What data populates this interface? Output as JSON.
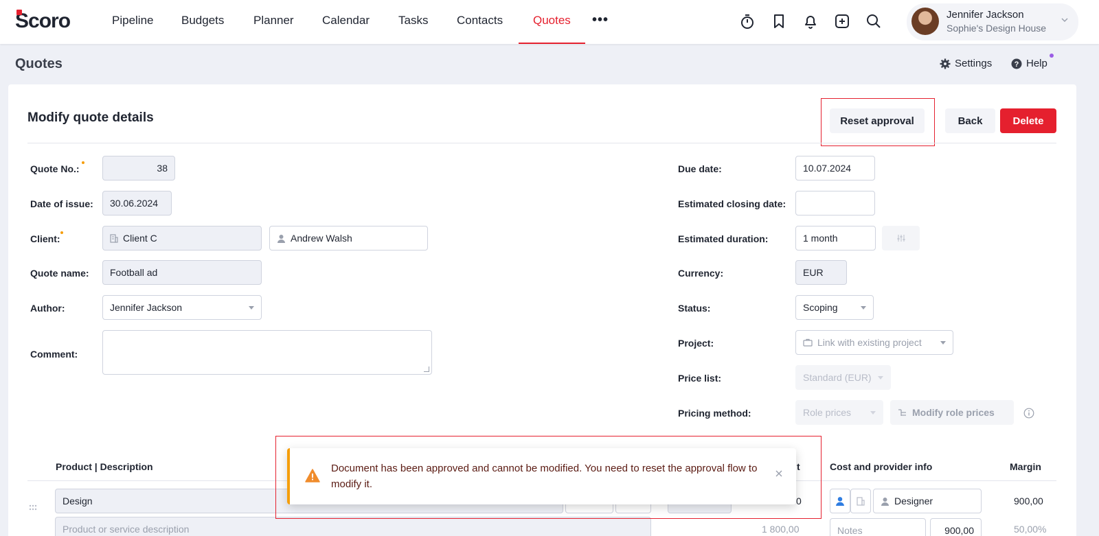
{
  "brand": {
    "logo_text": "Scoro",
    "accent": "#e5202e"
  },
  "nav": {
    "items": [
      {
        "label": "Pipeline"
      },
      {
        "label": "Budgets"
      },
      {
        "label": "Planner"
      },
      {
        "label": "Calendar"
      },
      {
        "label": "Tasks"
      },
      {
        "label": "Contacts"
      },
      {
        "label": "Quotes",
        "active": true
      }
    ],
    "more": "•••",
    "icons": [
      "timer-icon",
      "bookmark-icon",
      "bell-icon",
      "add-icon",
      "search-icon"
    ]
  },
  "user": {
    "name": "Jennifer Jackson",
    "company": "Sophie's Design House"
  },
  "page": {
    "title": "Quotes",
    "settings_label": "Settings",
    "help_label": "Help"
  },
  "card": {
    "title": "Modify quote details",
    "buttons": {
      "reset": "Reset approval",
      "back": "Back",
      "delete": "Delete"
    }
  },
  "form_left": {
    "quote_no": {
      "label": "Quote No.:",
      "value": "38"
    },
    "date_of_issue": {
      "label": "Date of issue:",
      "value": "30.06.2024"
    },
    "client": {
      "label": "Client:",
      "company": "Client C",
      "contact": "Andrew Walsh"
    },
    "quote_name": {
      "label": "Quote name:",
      "value": "Football ad"
    },
    "author": {
      "label": "Author:",
      "value": "Jennifer Jackson"
    },
    "comment": {
      "label": "Comment:",
      "value": ""
    }
  },
  "form_right": {
    "due_date": {
      "label": "Due date:",
      "value": "10.07.2024"
    },
    "estimated_closing_date": {
      "label": "Estimated closing date:",
      "value": ""
    },
    "estimated_duration": {
      "label": "Estimated duration:",
      "value": "1 month"
    },
    "currency": {
      "label": "Currency:",
      "value": "EUR"
    },
    "status": {
      "label": "Status:",
      "value": "Scoping"
    },
    "project": {
      "label": "Project:",
      "placeholder": "Link with existing project"
    },
    "price_list": {
      "label": "Price list:",
      "value": "Standard (EUR)"
    },
    "pricing_method": {
      "label": "Pricing method:",
      "value": "Role prices",
      "modify_label": "Modify role prices"
    }
  },
  "table": {
    "headers": {
      "product": "Product | Description",
      "amount_tail": "t",
      "cost": "Cost and provider info",
      "margin": "Margin"
    },
    "row": {
      "product": "Design",
      "description_placeholder": "Product or service description",
      "amount_tail": "0",
      "sum": "1 800,00",
      "provider": "Designer",
      "notes_placeholder": "Notes",
      "cost": "900,00",
      "margin": "900,00",
      "margin_pct": "50,00%"
    }
  },
  "notification": {
    "type": "warning",
    "color": "#f59e0b",
    "message": "Document has been approved and cannot be modified. You need to reset the approval flow to modify it."
  }
}
